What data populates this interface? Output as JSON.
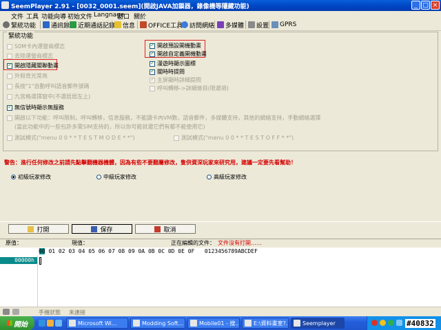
{
  "window": {
    "title": "SeemPlayer 2.91 - [0032_0001.seem](開啟JAVA加鎖器，錄像機等隱藏功能)"
  },
  "menu": [
    "文件",
    "工具",
    "功能向導",
    "初始文件",
    "Langnage",
    "窗口",
    "關於"
  ],
  "toolbar": [
    "緊統功能",
    "通訊錄",
    "近期通話記錄",
    "信息",
    "OFFICE工具",
    "訪問網絡",
    "多媒體",
    "設置",
    "GPRS"
  ],
  "group": {
    "title": "緊統功能",
    "left_options": [
      {
        "label": "S0M卡內運營商標志",
        "checked": false,
        "enabled": false
      },
      {
        "label": "去除運營商標志",
        "checked": false,
        "enabled": false
      },
      {
        "label": "開啟隱藏關聯動畫",
        "checked": true,
        "enabled": true,
        "highlight": true
      },
      {
        "label": "外殼背光常亮",
        "checked": false,
        "enabled": false
      },
      {
        "label": "長按\"1\"自動呼叫語音郵件號碼",
        "checked": false,
        "enabled": false
      },
      {
        "label": "九宮格選擇窗中(不選居居左上)",
        "checked": false,
        "enabled": false
      },
      {
        "label": "無信號時顯示無服務",
        "checked": true,
        "enabled": true
      }
    ],
    "right_options": [
      {
        "label": "開啟預設開機動畫",
        "checked": true,
        "enabled": true,
        "highlight": true
      },
      {
        "label": "開啟自定義開機動畫",
        "checked": true,
        "enabled": true,
        "highlight": true
      },
      {
        "label": "漫遊時顯示圖標",
        "checked": true,
        "enabled": true
      },
      {
        "label": "關時時提問",
        "checked": true,
        "enabled": true
      },
      {
        "label": "主屏顯時詳細提問",
        "checked": true,
        "enabled": false
      },
      {
        "label": "呼叫轉移->詳細條目(限選項)",
        "checked": false,
        "enabled": false
      }
    ],
    "long_option": "開啟以下功能：呼叫限制，呼叫轉移，信息服務，不能讀卡內VM數，語音郵件，多媒體支持，其他的網絡支持，手動網絡選擇",
    "long_option_note": "(當此功能中的一些包許多需SIM支持的，所以你可能就還它們有都不能使用它)",
    "test_left": "測試模式(\"menu 0 0 * * T E S T M O D E * *\")",
    "test_right": "測試模式(\"menu 0 0 * * T E S T O F F * *\")"
  },
  "warning": "警告：進行任何修改之前請先點擊翻機器機體，因為有些不要翻屬修改，隻供資深玩家來研究用，建議一定要先看幫助！",
  "levels": [
    {
      "label": "初級玩家修改",
      "selected": true
    },
    {
      "label": "中級玩家修改",
      "selected": false
    },
    {
      "label": "高級玩家修改",
      "selected": false
    }
  ],
  "buttons": {
    "open": "打開",
    "save": "保存",
    "cancel": "取消"
  },
  "status": {
    "orig_label": "原值：",
    "current_label": "現值：",
    "editing_label": "正在編輯的文件：",
    "editing_value": "文件沒有打開……"
  },
  "hex": {
    "header": "00 01 02 03 04 05 06 07 08 09 0A 0B 0C 0D 0E 0F   0123456789ABCDEF",
    "address": "00000h"
  },
  "bottom_status": [
    "手機狀態",
    "未連接"
  ],
  "taskbar": {
    "start": "開始",
    "tasks": [
      "Microsoft Wi...",
      "Modding Soft...",
      "Mobile01 - 搜...",
      "E:\\資料畫室?...",
      "Seemplayer"
    ],
    "watermark": "#40832"
  },
  "colors": {
    "highlight": "#e02020",
    "warning": "#d40000",
    "hex_accent": "#0a8a8a"
  }
}
